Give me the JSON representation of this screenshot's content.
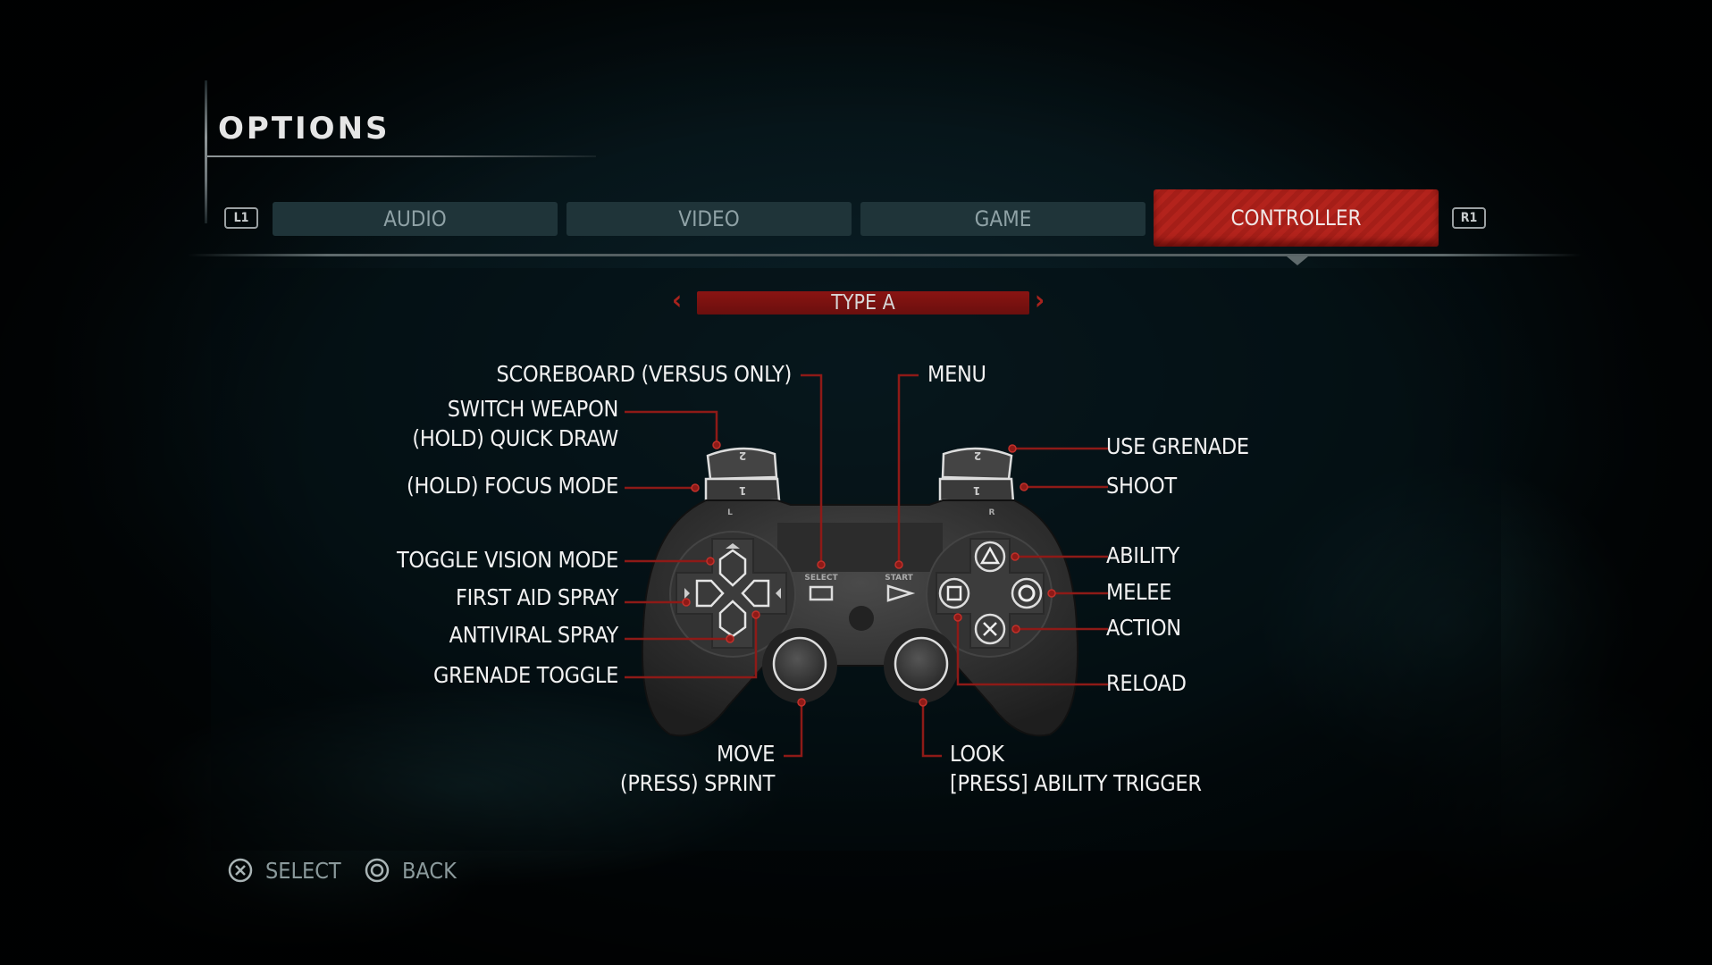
{
  "header": {
    "title": "OPTIONS"
  },
  "tabs": {
    "left_bumper": "L1",
    "right_bumper": "R1",
    "items": [
      {
        "label": "AUDIO",
        "active": false
      },
      {
        "label": "VIDEO",
        "active": false
      },
      {
        "label": "GAME",
        "active": false
      },
      {
        "label": "CONTROLLER",
        "active": true
      }
    ]
  },
  "layout_selector": {
    "value": "TYPE A",
    "prev_icon": "chevron-left-icon",
    "next_icon": "chevron-right-icon"
  },
  "controller": {
    "select_label": "SELECT",
    "start_label": "START",
    "left_grip_label": "L",
    "right_grip_label": "R",
    "trigger_1": "1",
    "trigger_2": "2"
  },
  "bindings": {
    "scoreboard": "SCOREBOARD (VERSUS ONLY)",
    "menu": "MENU",
    "switch_weapon": "SWITCH WEAPON",
    "quick_draw": "(HOLD) QUICK DRAW",
    "focus_mode": "(HOLD) FOCUS MODE",
    "use_grenade": "USE GRENADE",
    "shoot": "SHOOT",
    "toggle_vision": "TOGGLE VISION MODE",
    "first_aid": "FIRST AID SPRAY",
    "antiviral": "ANTIVIRAL SPRAY",
    "grenade_toggle": "GRENADE TOGGLE",
    "ability": "ABILITY",
    "melee": "MELEE",
    "action": "ACTION",
    "reload": "RELOAD",
    "move": "MOVE",
    "sprint": "(PRESS) SPRINT",
    "look": "LOOK",
    "ability_trigger": "[PRESS] ABILITY TRIGGER"
  },
  "footer": {
    "select": {
      "icon": "cross-button-icon",
      "label": "SELECT"
    },
    "back": {
      "icon": "circle-button-icon",
      "label": "BACK"
    }
  },
  "colors": {
    "accent_red": "#b3231c",
    "callout_red": "#8e1a17",
    "tab_inactive": "#1f3439",
    "text_dim": "#8fa2a6"
  }
}
